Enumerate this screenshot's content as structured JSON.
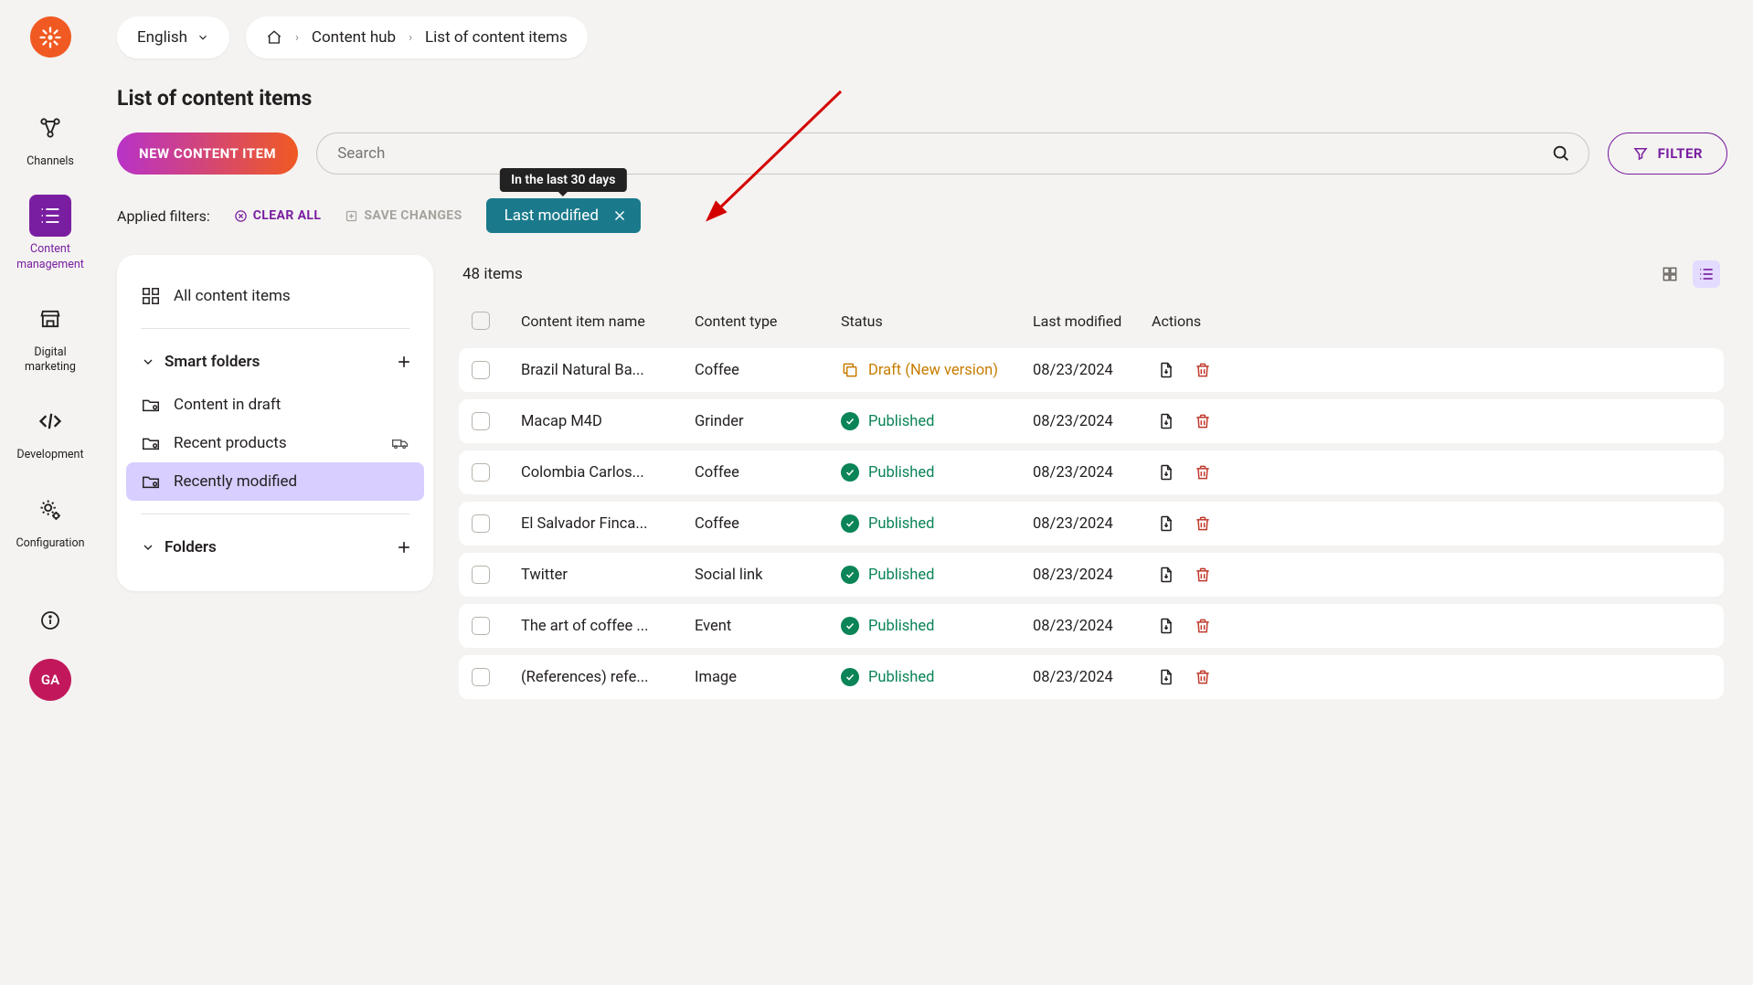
{
  "language": "English",
  "breadcrumb": {
    "item1": "Content hub",
    "item2": "List of content items"
  },
  "page_title": "List of content items",
  "buttons": {
    "new_content_item": "NEW CONTENT ITEM",
    "filter": "FILTER",
    "clear_all": "CLEAR ALL",
    "save_changes": "SAVE CHANGES"
  },
  "search": {
    "placeholder": "Search"
  },
  "applied_filters_label": "Applied filters:",
  "filter_chip": {
    "label": "Last modified",
    "tooltip": "In the last 30 days"
  },
  "nav": {
    "channels": "Channels",
    "content_mgmt": "Content\nmanagement",
    "digital_marketing": "Digital\nmarketing",
    "development": "Development",
    "configuration": "Configuration"
  },
  "user_initials": "GA",
  "sidebar": {
    "all_items": "All content items",
    "smart_folders": "Smart folders",
    "folders": "Folders",
    "smart": [
      {
        "label": "Content in draft"
      },
      {
        "label": "Recent products"
      },
      {
        "label": "Recently modified"
      }
    ]
  },
  "list": {
    "count_text": "48 items",
    "columns": {
      "name": "Content item name",
      "type": "Content type",
      "status": "Status",
      "modified": "Last modified",
      "actions": "Actions"
    },
    "rows": [
      {
        "name": "Brazil Natural Ba...",
        "type": "Coffee",
        "status": "draft",
        "status_label": "Draft (New version)",
        "date": "08/23/2024"
      },
      {
        "name": "Macap M4D",
        "type": "Grinder",
        "status": "published",
        "status_label": "Published",
        "date": "08/23/2024"
      },
      {
        "name": "Colombia Carlos...",
        "type": "Coffee",
        "status": "published",
        "status_label": "Published",
        "date": "08/23/2024"
      },
      {
        "name": "El Salvador Finca...",
        "type": "Coffee",
        "status": "published",
        "status_label": "Published",
        "date": "08/23/2024"
      },
      {
        "name": "Twitter",
        "type": "Social link",
        "status": "published",
        "status_label": "Published",
        "date": "08/23/2024"
      },
      {
        "name": "The art of coffee ...",
        "type": "Event",
        "status": "published",
        "status_label": "Published",
        "date": "08/23/2024"
      },
      {
        "name": "(References) refe...",
        "type": "Image",
        "status": "published",
        "status_label": "Published",
        "date": "08/23/2024"
      }
    ]
  }
}
